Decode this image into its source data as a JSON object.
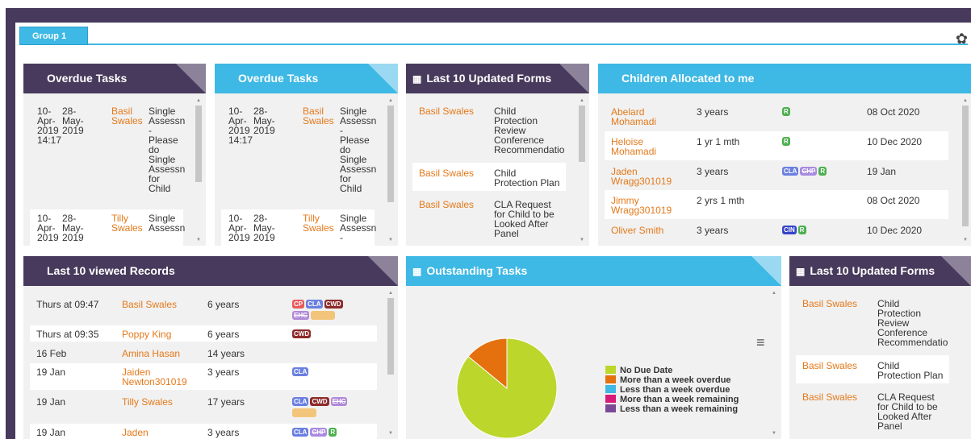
{
  "tab": "Group 1",
  "panels": {
    "overdue1": {
      "title": "Overdue Tasks"
    },
    "overdue2": {
      "title": "Overdue Tasks"
    },
    "forms1": {
      "title": "Last 10 Updated Forms"
    },
    "children": {
      "title": "Children Allocated to me"
    },
    "viewed": {
      "title": "Last 10 viewed Records"
    },
    "outstanding": {
      "title": "Outstanding Tasks"
    },
    "forms2": {
      "title": "Last 10 Updated Forms"
    }
  },
  "overdue_rows": [
    {
      "created": [
        "10-",
        "Apr-",
        "2019",
        "14:17"
      ],
      "due": [
        "28-",
        "May-",
        "2019"
      ],
      "name": [
        "Basil",
        "Swales"
      ],
      "task": [
        "Single",
        "Assessn",
        "-",
        "Please",
        "do",
        "Single",
        "Assessn",
        "for",
        "Child"
      ]
    },
    {
      "created": [
        "10-",
        "Apr-",
        "2019"
      ],
      "due": [
        "28-",
        "May-",
        "2019"
      ],
      "name": [
        "Tilly",
        "Swales"
      ],
      "task": [
        "Single",
        "Assessn"
      ]
    }
  ],
  "overdue2_rows": [
    {
      "created": [
        "10-",
        "Apr-",
        "2019",
        "14:17"
      ],
      "due": [
        "28-",
        "May-",
        "2019"
      ],
      "name": [
        "Basil",
        "Swales"
      ],
      "task": [
        "Single",
        "Assessn",
        "-",
        "Please",
        "do",
        "Single",
        "Assessn",
        "for",
        "Child"
      ]
    },
    {
      "created": [
        "10-",
        "Apr-",
        "2019"
      ],
      "due": [
        "28-",
        "May-",
        "2019"
      ],
      "name": [
        "Tilly",
        "Swales"
      ],
      "task": [
        "Single",
        "Assessn",
        "-"
      ]
    }
  ],
  "forms_rows": [
    {
      "name": "Basil Swales",
      "form": [
        "Child",
        "Protection",
        "Review",
        "Conference",
        "Recommendatio"
      ]
    },
    {
      "name": "Basil Swales",
      "form": [
        "Child",
        "Protection Plan"
      ]
    },
    {
      "name": "Basil Swales",
      "form": [
        "CLA Request",
        "for Child to be",
        "Looked After",
        "Panel"
      ]
    }
  ],
  "children_rows": [
    {
      "name": [
        "Abelard",
        "Mohamadi"
      ],
      "age": "3 years",
      "badges": [
        "R"
      ],
      "date": "08 Oct 2020"
    },
    {
      "name": [
        "Heloise",
        "Mohamadi"
      ],
      "age": "1 yr 1 mth",
      "badges": [
        "R"
      ],
      "date": "10 Dec 2020"
    },
    {
      "name": [
        "Jaden",
        "Wragg301019"
      ],
      "age": "3 years",
      "badges": [
        "CLA",
        "CHP",
        "R"
      ],
      "date": "19 Jan"
    },
    {
      "name": [
        "Jimmy",
        "Wragg301019"
      ],
      "age": "2 yrs 1 mth",
      "badges": [],
      "date": "08 Oct 2020"
    },
    {
      "name": [
        "Oliver Smith"
      ],
      "age": "3 years",
      "badges": [
        "CIN",
        "R"
      ],
      "date": "10 Dec 2020"
    }
  ],
  "viewed_rows": [
    {
      "when": "Thurs at 09:47",
      "name": [
        "Basil Swales"
      ],
      "age": "6 years",
      "badges": [
        "CP",
        "CLA",
        "CWD",
        "EHC",
        "Y"
      ]
    },
    {
      "when": "Thurs at 09:35",
      "name": [
        "Poppy King"
      ],
      "age": "6 years",
      "badges": [
        "CWD"
      ]
    },
    {
      "when": "16 Feb",
      "name": [
        "Amina Hasan"
      ],
      "age": "14 years",
      "badges": []
    },
    {
      "when": "19 Jan",
      "name": [
        "Jaiden",
        "Newton301019"
      ],
      "age": "3 years",
      "badges": [
        "CLA"
      ]
    },
    {
      "when": "19 Jan",
      "name": [
        "Tilly Swales"
      ],
      "age": "17 years",
      "badges": [
        "CLA",
        "CWD",
        "EHC",
        "Y"
      ]
    },
    {
      "when": "19 Jan",
      "name": [
        "Jaden"
      ],
      "age": "3 years",
      "badges": [
        "CLA",
        "CHP",
        "R"
      ]
    }
  ],
  "chart_data": {
    "type": "pie",
    "title": "",
    "legend_position": "right",
    "series": [
      {
        "name": "No Due Date",
        "value": 86,
        "color": "#bcd62b"
      },
      {
        "name": "More than a week overdue",
        "value": 14,
        "color": "#e5700e"
      },
      {
        "name": "Less than a week overdue",
        "value": 0,
        "color": "#3eb8e4"
      },
      {
        "name": "More than a week remaining",
        "value": 0,
        "color": "#d81b78"
      },
      {
        "name": "Less than a week remaining",
        "value": 0,
        "color": "#7b4a96"
      }
    ]
  },
  "icons": {
    "settings": "gear-icon",
    "chart_menu": "hamburger-menu-icon",
    "forms": "grid-icon"
  }
}
